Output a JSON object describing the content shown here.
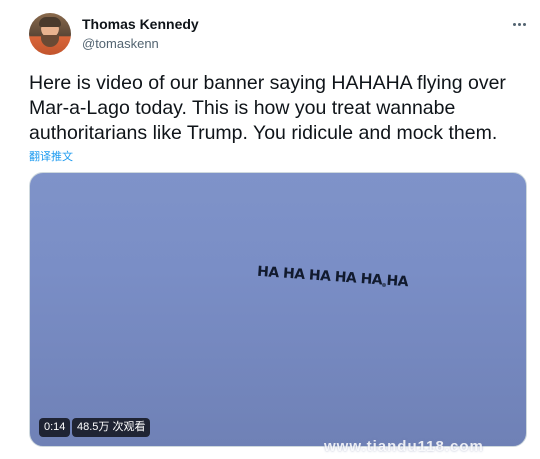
{
  "author": {
    "display_name": "Thomas Kennedy",
    "handle": "@tomaskenn",
    "avatar_icon": "profile-photo"
  },
  "more_icon": "ellipsis-icon",
  "tweet": {
    "text": "Here is video of our banner saying HAHAHA flying over Mar-a-Lago today. This is how you treat wannabe authoritarians like Trump. You ridicule and mock them.",
    "translate_label": "翻译推文"
  },
  "media": {
    "banner_text": "HA HA HA HA HA HA",
    "duration": "0:14",
    "views": "48.5万 次观看",
    "sky_color": "#7a8ec6"
  },
  "watermark": "www.tiandu118.com"
}
